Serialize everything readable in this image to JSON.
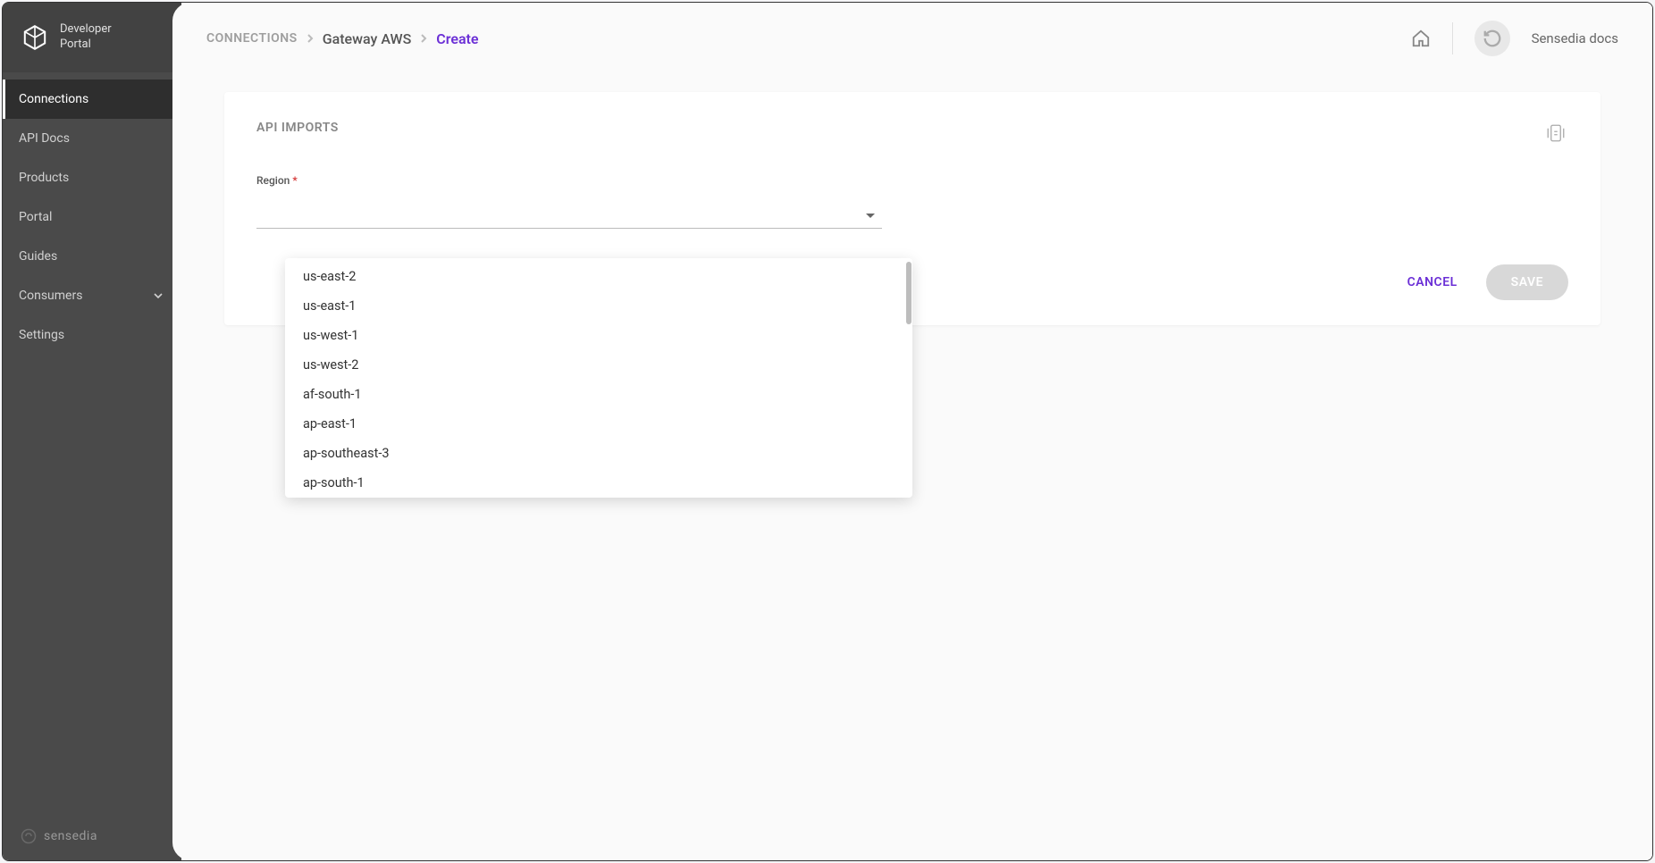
{
  "sidebar": {
    "brand_line1": "Developer",
    "brand_line2": "Portal",
    "items": [
      {
        "label": "Connections",
        "active": true
      },
      {
        "label": "API Docs"
      },
      {
        "label": "Products"
      },
      {
        "label": "Portal"
      },
      {
        "label": "Guides"
      },
      {
        "label": "Consumers",
        "expandable": true
      },
      {
        "label": "Settings"
      }
    ],
    "footer_brand": "sensedia"
  },
  "breadcrumb": {
    "root": "CONNECTIONS",
    "mid": "Gateway AWS",
    "current": "Create"
  },
  "topbar": {
    "user_name": "Sensedia docs"
  },
  "form": {
    "section_title": "API IMPORTS",
    "region_label": "Region",
    "region_value": "",
    "region_options": [
      "us-east-2",
      "us-east-1",
      "us-west-1",
      "us-west-2",
      "af-south-1",
      "ap-east-1",
      "ap-southeast-3",
      "ap-south-1"
    ]
  },
  "actions": {
    "cancel": "CANCEL",
    "save": "SAVE"
  }
}
